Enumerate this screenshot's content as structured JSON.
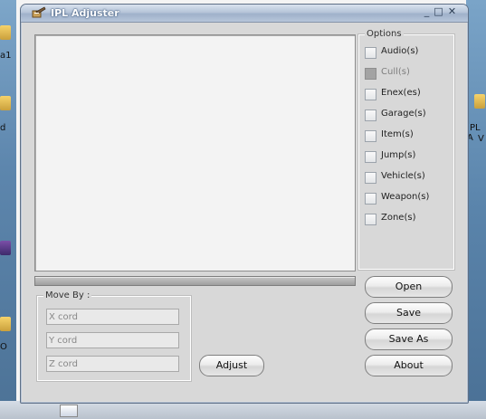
{
  "window": {
    "title": "IPL Adjuster",
    "minimize": "_",
    "maximize": "□",
    "close": "✕"
  },
  "desktop": {
    "left_labels": [
      "a1",
      "d",
      "O"
    ],
    "right_labels": [
      "IPL A",
      "V"
    ]
  },
  "options": {
    "legend": "Options",
    "items": [
      {
        "label": "Audio(s)",
        "disabled": false
      },
      {
        "label": "Cull(s)",
        "disabled": true
      },
      {
        "label": "Enex(es)",
        "disabled": false
      },
      {
        "label": "Garage(s)",
        "disabled": false
      },
      {
        "label": "Item(s)",
        "disabled": false
      },
      {
        "label": "Jump(s)",
        "disabled": false
      },
      {
        "label": "Vehicle(s)",
        "disabled": false
      },
      {
        "label": "Weapon(s)",
        "disabled": false
      },
      {
        "label": "Zone(s)",
        "disabled": false
      }
    ]
  },
  "move_by": {
    "legend": "Move By :",
    "x_placeholder": "X cord",
    "y_placeholder": "Y cord",
    "z_placeholder": "Z cord"
  },
  "buttons": {
    "adjust": "Adjust",
    "open": "Open",
    "save": "Save",
    "save_as": "Save As",
    "about": "About"
  }
}
